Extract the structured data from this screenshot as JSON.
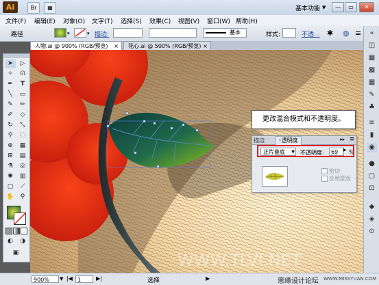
{
  "app": {
    "logo": "Ai",
    "workspace": "基本功能",
    "minimize": "—",
    "restore": "▭",
    "close": "✕"
  },
  "titlebar": {
    "buttons": [
      "Br",
      "▦"
    ]
  },
  "menu": [
    "文件(F)",
    "编辑(E)",
    "对象(O)",
    "文字(T)",
    "选择(S)",
    "效果(C)",
    "视图(V)",
    "窗口(W)",
    "帮助(H)"
  ],
  "control": {
    "path_label": "路径",
    "stroke_label": "描边:",
    "style_preset": "基本",
    "style_label": "样式:",
    "opacity_link": "不透..."
  },
  "tabs": [
    {
      "label": "人物.ai @ 900% (RGB/预览)",
      "close": "×"
    },
    {
      "label": "花心.ai @ 500% (RGB/预览)",
      "close": "×"
    }
  ],
  "panel": {
    "tab_stroke": "描边",
    "tab_transparency": "◦透明度",
    "blend_mode": "正片叠底",
    "opacity_label": "不透明度:",
    "opacity_value": "69",
    "percent": "%",
    "clip_label": "剪切",
    "invert_label": "反相蒙版"
  },
  "callout": {
    "text": "更改混合模式和不透明度。"
  },
  "status": {
    "zoom": "900%",
    "page": "1",
    "mode": "选择"
  },
  "watermark": {
    "site": "WWW.TLVI.NET",
    "brand": "思缘设计论坛",
    "url": "WWW.MISSYUAN.COM"
  },
  "colors": {
    "highlight": "#e11c1c",
    "accent": "#2f5f9a"
  }
}
